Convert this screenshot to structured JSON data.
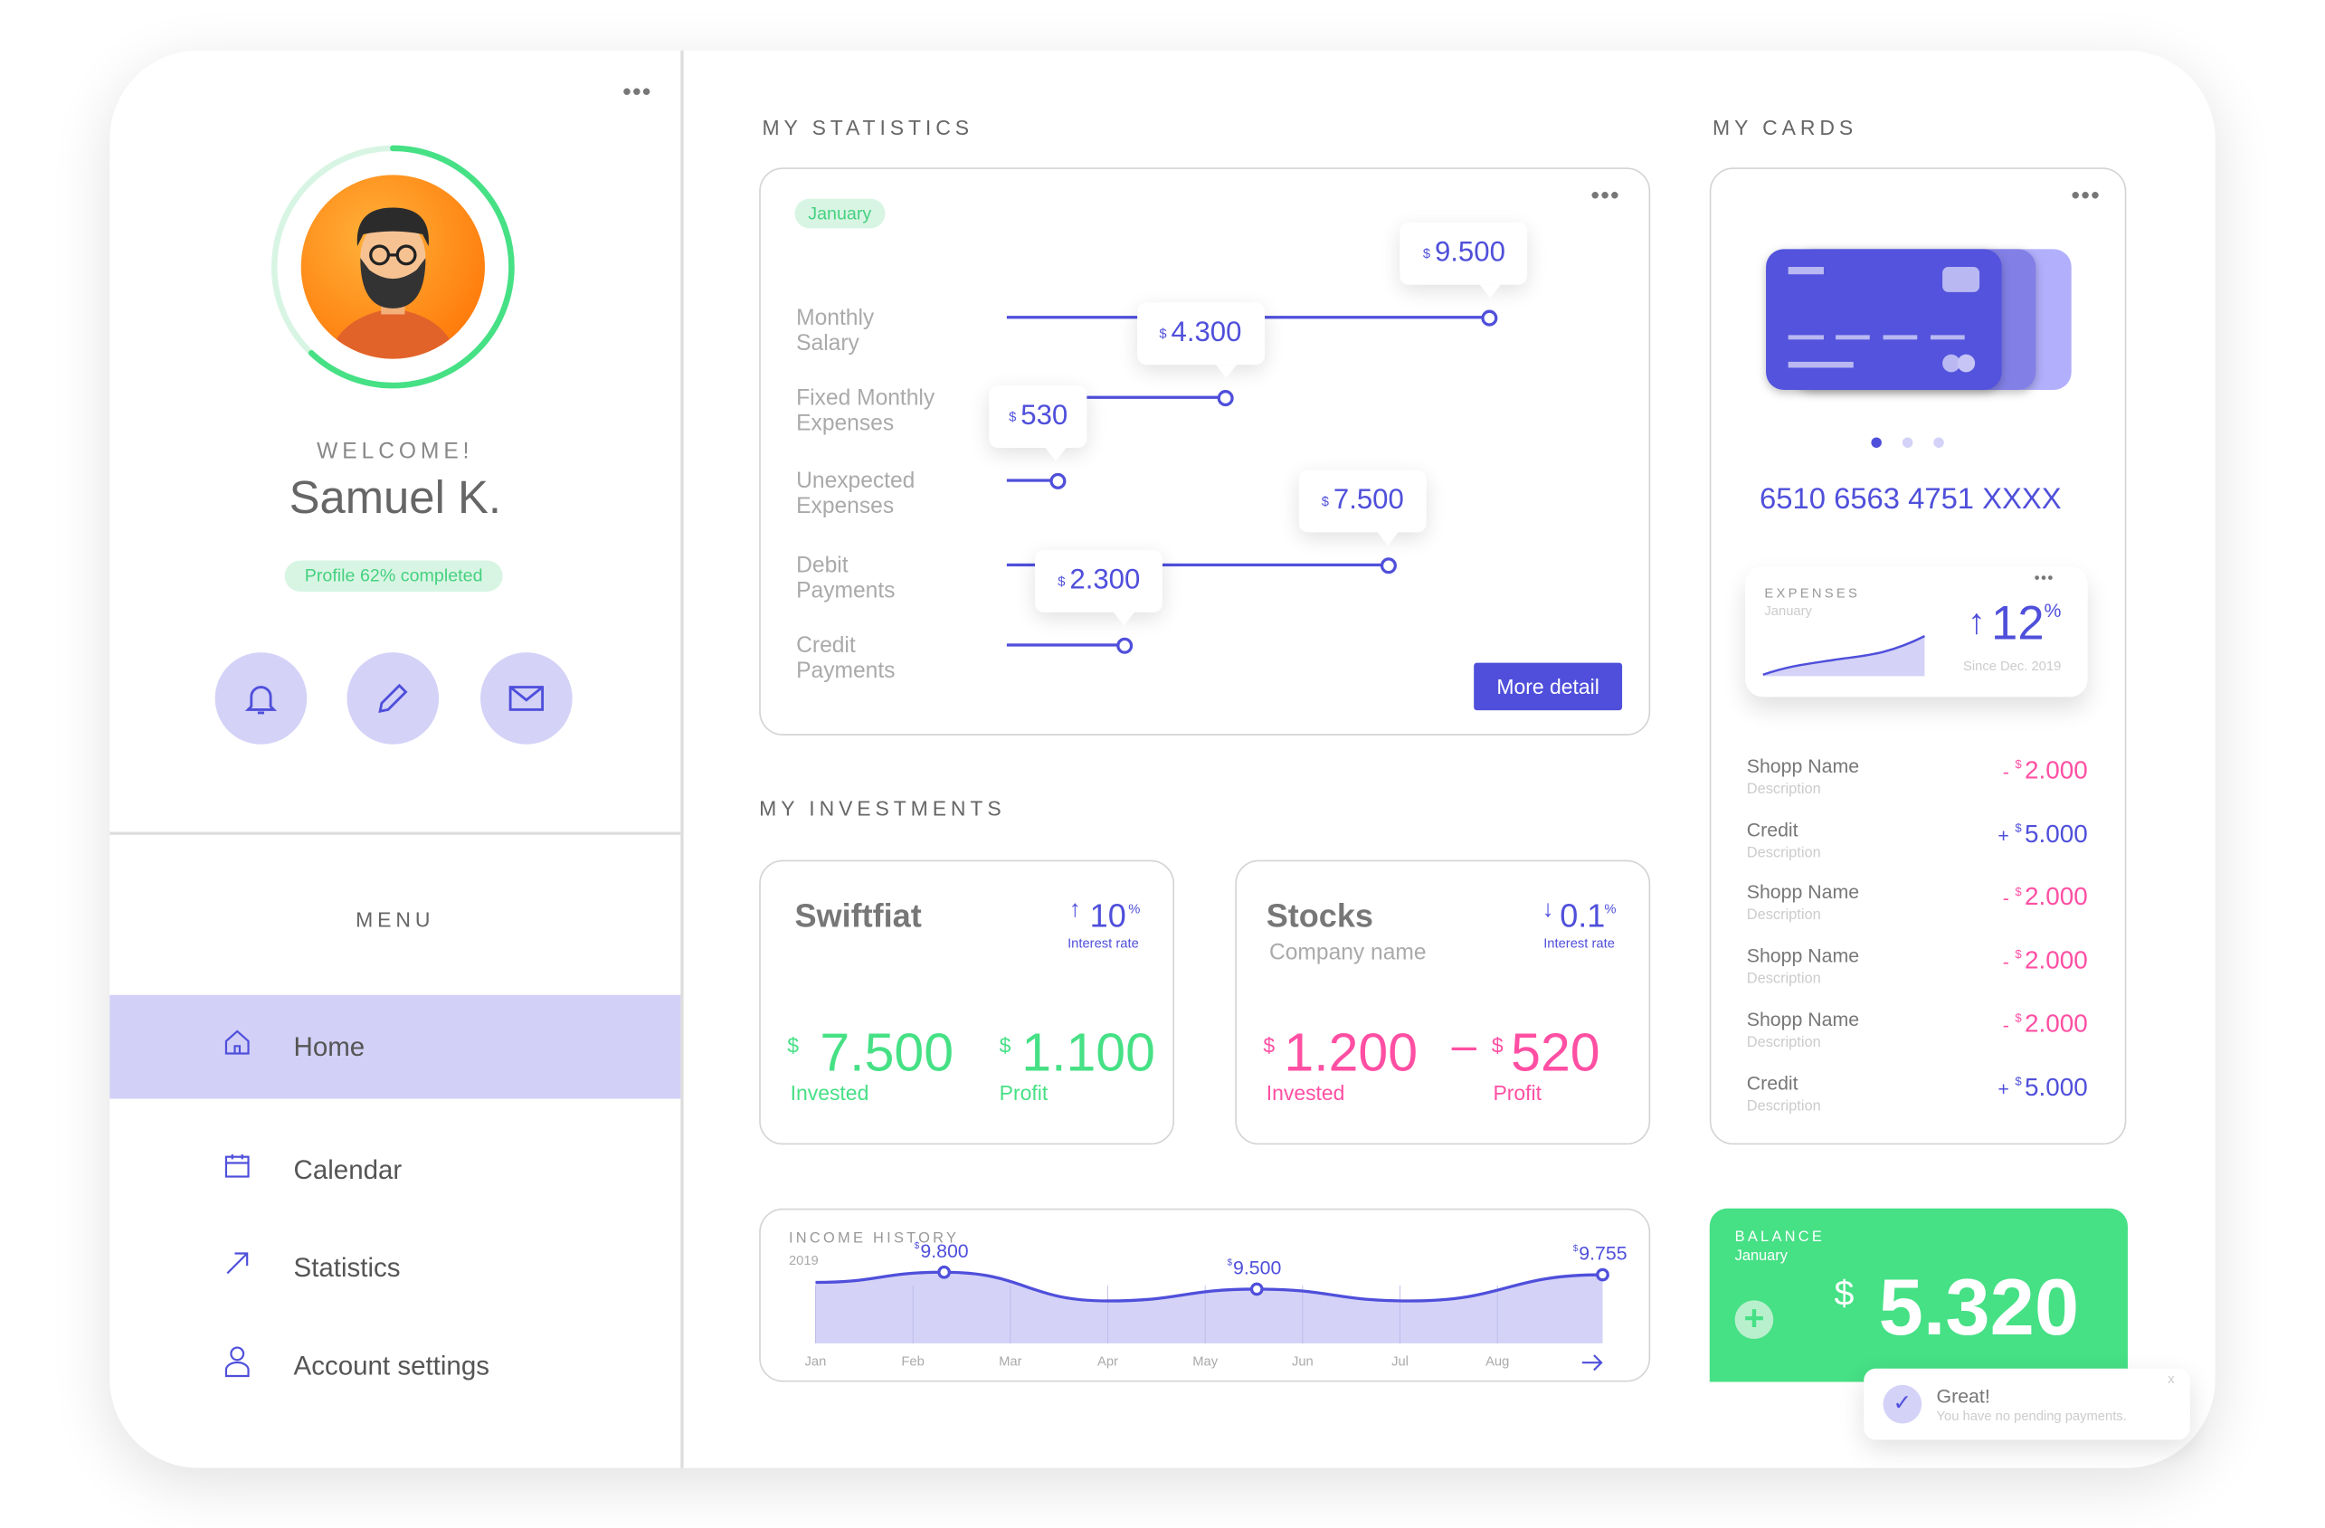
{
  "sidebar": {
    "welcome": "WELCOME!",
    "user_name": "Samuel K.",
    "profile_badge": "Profile 62% completed",
    "profile_progress": 0.62,
    "menu_title": "MENU",
    "items": [
      {
        "label": "Home",
        "icon": "home-icon",
        "active": true
      },
      {
        "label": "Calendar",
        "icon": "calendar-icon"
      },
      {
        "label": "Statistics",
        "icon": "arrow-up-right-icon"
      },
      {
        "label": "Account settings",
        "icon": "user-icon"
      }
    ]
  },
  "statistics": {
    "title": "MY STATISTICS",
    "month_badge": "January",
    "currency": "$",
    "rows": [
      {
        "label1": "Monthly",
        "label2": "Salary",
        "value": 9500,
        "display": "9.500"
      },
      {
        "label1": "Fixed Monthly",
        "label2": "Expenses",
        "value": 4300,
        "display": "4.300"
      },
      {
        "label1": "Unexpected",
        "label2": "Expenses",
        "value": 530,
        "display": "530"
      },
      {
        "label1": "Debit",
        "label2": "Payments",
        "value": 7500,
        "display": "7.500"
      },
      {
        "label1": "Credit",
        "label2": "Payments",
        "value": 2300,
        "display": "2.300"
      }
    ],
    "more_button": "More detail"
  },
  "investments": {
    "title": "MY INVESTMENTS",
    "items": [
      {
        "name": "Swiftfiat",
        "subtitle": "",
        "rate": "10",
        "rate_dir": "↑",
        "rate_label": "Interest rate",
        "invested": "7.500",
        "profit": "1.100",
        "profit_sign": "",
        "invested_label": "Invested",
        "profit_label": "Profit",
        "color": "#46e085"
      },
      {
        "name": "Stocks",
        "subtitle": "Company name",
        "rate": "0.1",
        "rate_dir": "↓",
        "rate_label": "Interest rate",
        "invested": "1.200",
        "profit": "520",
        "profit_sign": "–",
        "invested_label": "Invested",
        "profit_label": "Profit",
        "color": "#ff4fa3"
      }
    ]
  },
  "income": {
    "title": "INCOME HISTORY",
    "year": "2019"
  },
  "chart_data": {
    "type": "area",
    "title": "INCOME HISTORY",
    "categories": [
      "Jan",
      "Feb",
      "Mar",
      "Apr",
      "May",
      "Jun",
      "Jul",
      "Aug"
    ],
    "points": [
      [
        0,
        9620
      ],
      [
        1.32,
        9800
      ],
      [
        3.0,
        9290
      ],
      [
        4.53,
        9500
      ],
      [
        6.1,
        9290
      ],
      [
        8.08,
        9755
      ]
    ],
    "labeled": [
      {
        "x": 1.32,
        "value": 9800,
        "label": "9.800"
      },
      {
        "x": 4.53,
        "value": 9500,
        "label": "9.500"
      },
      {
        "x": 8.08,
        "value": 9755,
        "label": "9.755"
      }
    ],
    "ylim": [
      9000,
      10000
    ],
    "color": "#4f4fdb",
    "fill": "#d4d2f7",
    "grid": "vertical"
  },
  "cards": {
    "title": "MY CARDS",
    "card_number": "6510 6563 4751 XXXX",
    "carousel_count": 3,
    "carousel_active": 0,
    "expenses": {
      "title": "EXPENSES",
      "month": "January",
      "change": "12",
      "arrow": "↑",
      "unit": "%",
      "since": "Since Dec. 2019"
    },
    "transactions": [
      {
        "name": "Shopp Name",
        "desc": "Description",
        "sign": "-",
        "amount": "2.000",
        "type": "debit"
      },
      {
        "name": "Credit",
        "desc": "Description",
        "sign": "+",
        "amount": "5.000",
        "type": "credit"
      },
      {
        "name": "Shopp Name",
        "desc": "Description",
        "sign": "-",
        "amount": "2.000",
        "type": "debit"
      },
      {
        "name": "Shopp Name",
        "desc": "Description",
        "sign": "-",
        "amount": "2.000",
        "type": "debit"
      },
      {
        "name": "Shopp Name",
        "desc": "Description",
        "sign": "-",
        "amount": "2.000",
        "type": "debit"
      },
      {
        "name": "Credit",
        "desc": "Description",
        "sign": "+",
        "amount": "5.000",
        "type": "credit"
      }
    ]
  },
  "balance": {
    "title": "BALANCE",
    "month": "January",
    "currency": "$",
    "amount": "5.320"
  },
  "toast": {
    "title": "Great!",
    "message": "You have no pending payments.",
    "close": "x"
  },
  "colors": {
    "accent": "#4f4fdb",
    "green": "#46e085",
    "pink": "#ff4fa3",
    "lavender": "#d4d2f7"
  }
}
